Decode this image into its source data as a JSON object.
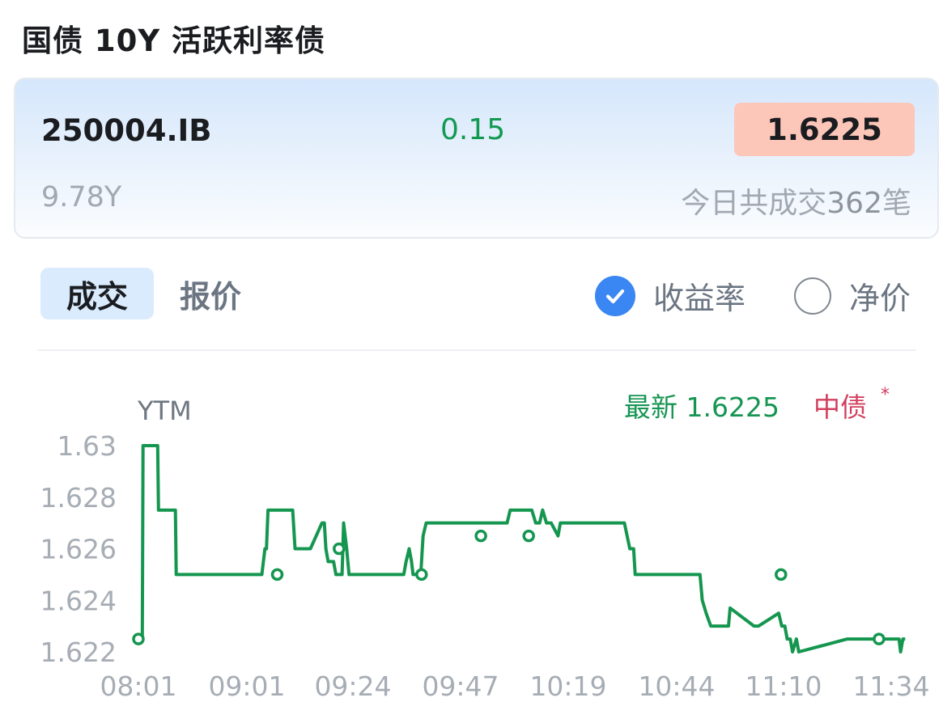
{
  "page": {
    "title": "国债 10Y 活跃利率债"
  },
  "quote": {
    "code": "250004.IB",
    "change": "0.15",
    "yield": "1.6225",
    "term": "9.78Y",
    "trades_prefix": "今日共成交",
    "trades_count": "362",
    "trades_suffix": "笔"
  },
  "tabs": [
    {
      "label": "成交",
      "active": true
    },
    {
      "label": "报价",
      "active": false
    }
  ],
  "options": {
    "yield": {
      "label": "收益率",
      "checked": true,
      "icon": "check-circle-icon"
    },
    "clean_price": {
      "label": "净价",
      "checked": false,
      "icon": "radio-circle-icon"
    }
  },
  "legend": {
    "latest_label": "最新",
    "latest_value": "1.6225",
    "source": "中债",
    "source_marker": "*"
  },
  "colors": {
    "line": "#15964f",
    "accent_blue": "#3a86f3",
    "badge_bg": "#fcc6b9",
    "source": "#d2405f"
  },
  "chart_data": {
    "type": "line",
    "ylabel": "YTM",
    "ylim": [
      1.6215,
      1.63
    ],
    "y_ticks": [
      "1.63",
      "1.628",
      "1.626",
      "1.624",
      "1.622"
    ],
    "y_tick_values": [
      1.63,
      1.628,
      1.626,
      1.624,
      1.622
    ],
    "x_ticks": [
      "08:01",
      "09:01",
      "09:24",
      "09:47",
      "10:19",
      "10:44",
      "11:10",
      "11:34"
    ],
    "x_range": [
      0,
      100
    ],
    "series": [
      {
        "x": [
          0,
          0.5,
          0.6,
          2.5,
          2.6,
          4.8,
          4.9,
          14.5,
          15.0,
          16.0,
          16.4,
          16.6,
          16.8,
          20.0,
          20.3,
          21.5,
          22.3,
          23.8,
          24.1,
          24.3,
          24.6,
          25.3,
          25.6,
          26.4,
          26.6,
          26.8,
          27.0,
          27.3,
          34.4,
          34.7,
          35.1,
          35.4,
          35.6,
          36.6,
          36.9,
          37.3,
          47.8,
          48.2,
          48.7,
          49.3,
          51.0,
          51.5,
          52.0,
          52.4,
          52.9,
          53.5,
          54.4,
          54.7,
          55.0,
          55.4,
          63.0,
          63.7,
          64.2,
          64.4,
          64.6,
          72.8,
          73.1,
          73.6,
          74.2,
          76.5,
          76.7,
          79.8,
          80.4,
          83.0,
          83.4,
          83.8,
          84.1,
          84.5,
          84.8,
          85.3,
          85.6,
          91.9,
          92.3,
          92.6,
          98.6,
          98.8,
          99.1,
          99.4
        ],
        "y": [
          1.6225,
          1.6225,
          1.63,
          1.63,
          1.6275,
          1.6275,
          1.625,
          1.625,
          1.625,
          1.625,
          1.626,
          1.626,
          1.6275,
          1.6275,
          1.626,
          1.626,
          1.626,
          1.627,
          1.627,
          1.626,
          1.6255,
          1.6255,
          1.625,
          1.625,
          1.627,
          1.6265,
          1.626,
          1.625,
          1.625,
          1.6255,
          1.626,
          1.6255,
          1.625,
          1.625,
          1.6265,
          1.627,
          1.627,
          1.6275,
          1.6275,
          1.6275,
          1.6275,
          1.627,
          1.627,
          1.6275,
          1.627,
          1.627,
          1.6265,
          1.627,
          1.627,
          1.627,
          1.627,
          1.626,
          1.626,
          1.625,
          1.625,
          1.625,
          1.624,
          1.6235,
          1.623,
          1.623,
          1.6237,
          1.623,
          1.623,
          1.6235,
          1.623,
          1.623,
          1.6225,
          1.6225,
          1.622,
          1.6225,
          1.622,
          1.6225,
          1.6225,
          1.6225,
          1.6225,
          1.622,
          1.6225,
          1.6225
        ],
        "markers_x": [
          0,
          18.0,
          26.0,
          36.7,
          44.4,
          50.6,
          83.3,
          96.0
        ],
        "markers_y": [
          1.6225,
          1.625,
          1.626,
          1.625,
          1.6265,
          1.6265,
          1.625,
          1.6225
        ]
      }
    ]
  }
}
